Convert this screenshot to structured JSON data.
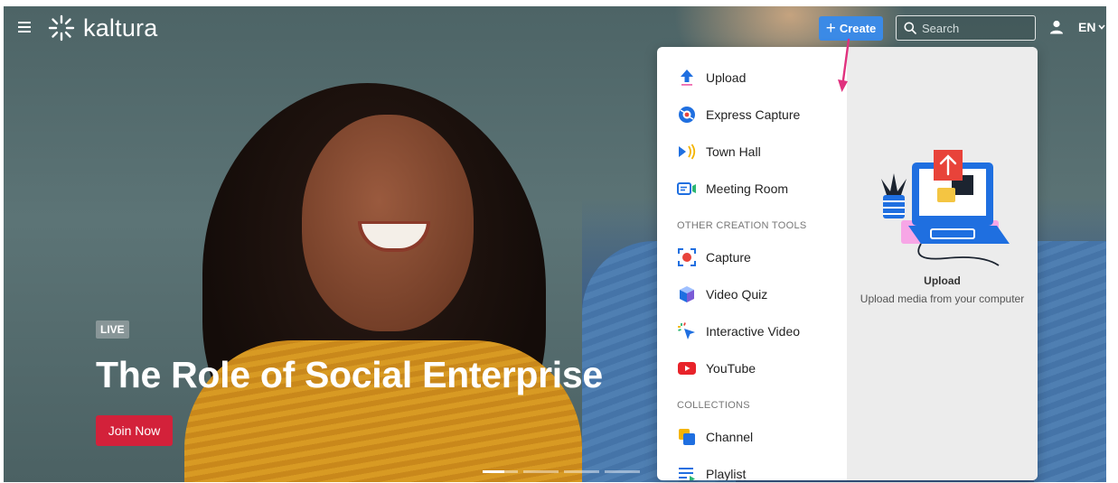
{
  "header": {
    "logo_text": "kaltura",
    "create_label": "Create",
    "search_placeholder": "Search",
    "language": "EN"
  },
  "hero": {
    "badge": "LIVE",
    "title": "The Role of Social Enterprise",
    "cta_label": "Join Now",
    "carousel": {
      "slides": 4,
      "active_index": 0
    }
  },
  "create_menu": {
    "items": [
      {
        "label": "Upload",
        "icon": "upload-arrow-icon"
      },
      {
        "label": "Express Capture",
        "icon": "express-capture-icon"
      },
      {
        "label": "Town Hall",
        "icon": "town-hall-icon"
      },
      {
        "label": "Meeting Room",
        "icon": "meeting-room-icon"
      }
    ],
    "other_section_label": "OTHER CREATION TOOLS",
    "other_items": [
      {
        "label": "Capture",
        "icon": "capture-icon"
      },
      {
        "label": "Video Quiz",
        "icon": "video-quiz-icon"
      },
      {
        "label": "Interactive Video",
        "icon": "interactive-video-icon"
      },
      {
        "label": "YouTube",
        "icon": "youtube-icon"
      }
    ],
    "collections_section_label": "COLLECTIONS",
    "collection_items": [
      {
        "label": "Channel",
        "icon": "channel-icon"
      },
      {
        "label": "Playlist",
        "icon": "playlist-icon"
      }
    ],
    "preview": {
      "title": "Upload",
      "description": "Upload media from your computer"
    }
  },
  "colors": {
    "create_button": "#3b8ae6",
    "join_button": "#d3213a",
    "annotation_arrow": "#e0317e"
  }
}
